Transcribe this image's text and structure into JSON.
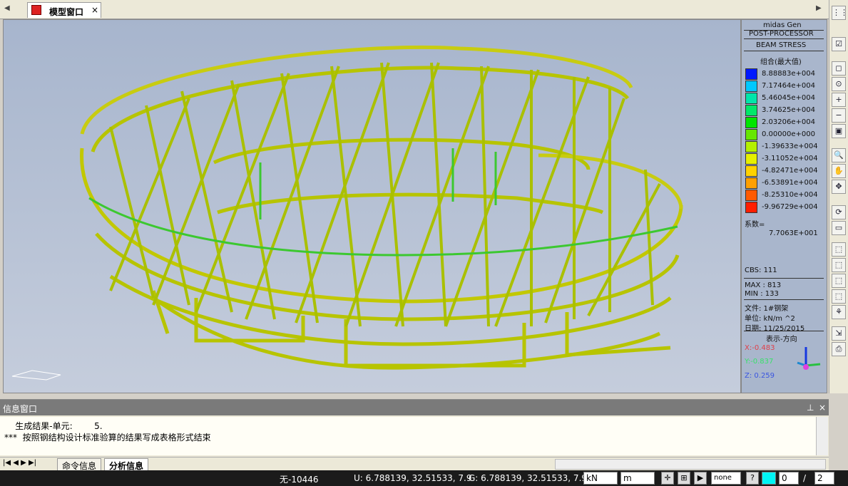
{
  "tabs": {
    "active_label": "模型窗口",
    "close": "×"
  },
  "legend": {
    "title1": "midas Gen",
    "title2": "POST-PROCESSOR",
    "title3": "BEAM STRESS",
    "combo": "组合(最大值)",
    "entries": [
      {
        "value": "8.88883e+004",
        "color": "#0019ff"
      },
      {
        "value": "7.17464e+004",
        "color": "#00c8ff"
      },
      {
        "value": "5.46045e+004",
        "color": "#00e6aa"
      },
      {
        "value": "3.74625e+004",
        "color": "#00e86a"
      },
      {
        "value": "2.03206e+004",
        "color": "#00e600"
      },
      {
        "value": "0.00000e+000",
        "color": "#66e600"
      },
      {
        "value": "-1.39633e+004",
        "color": "#b4f000"
      },
      {
        "value": "-3.11052e+004",
        "color": "#e6f000"
      },
      {
        "value": "-4.82471e+004",
        "color": "#ffd200"
      },
      {
        "value": "-6.53891e+004",
        "color": "#ffa000"
      },
      {
        "value": "-8.25310e+004",
        "color": "#ff5a00"
      },
      {
        "value": "-9.96729e+004",
        "color": "#ff1e00"
      }
    ],
    "factor_label": "系数=",
    "factor_value": "7.7063E+001",
    "cbs": "CBS: 111",
    "max": "MAX : 813",
    "min": "MIN : 133",
    "file": "文件: 1#钢架",
    "unit": "单位: kN/m ^2",
    "date": "日期: 11/25/2015",
    "dir_title": "表示-方向",
    "x": "X:-0.483",
    "y": "Y:-0.837",
    "z": "Z: 0.259"
  },
  "info": {
    "title": "信息窗口",
    "pin": "⊥",
    "close": "×",
    "lines": [
      "    生成结果-单元:        5.",
      "***  按照钢结构设计标准验算的结果写成表格形式结束"
    ],
    "tab1": "命令信息",
    "tab2": "分析信息"
  },
  "status": {
    "none_elem": "无-10446",
    "u": "U: 6.788139, 32.51533, 7.9",
    "g": "G: 6.788139, 32.51533, 7.9",
    "force_unit": "kN",
    "length_unit": "m",
    "none_sel": "none",
    "help": "?",
    "page_current": "0",
    "page_sep": "/",
    "page_total": "2"
  }
}
